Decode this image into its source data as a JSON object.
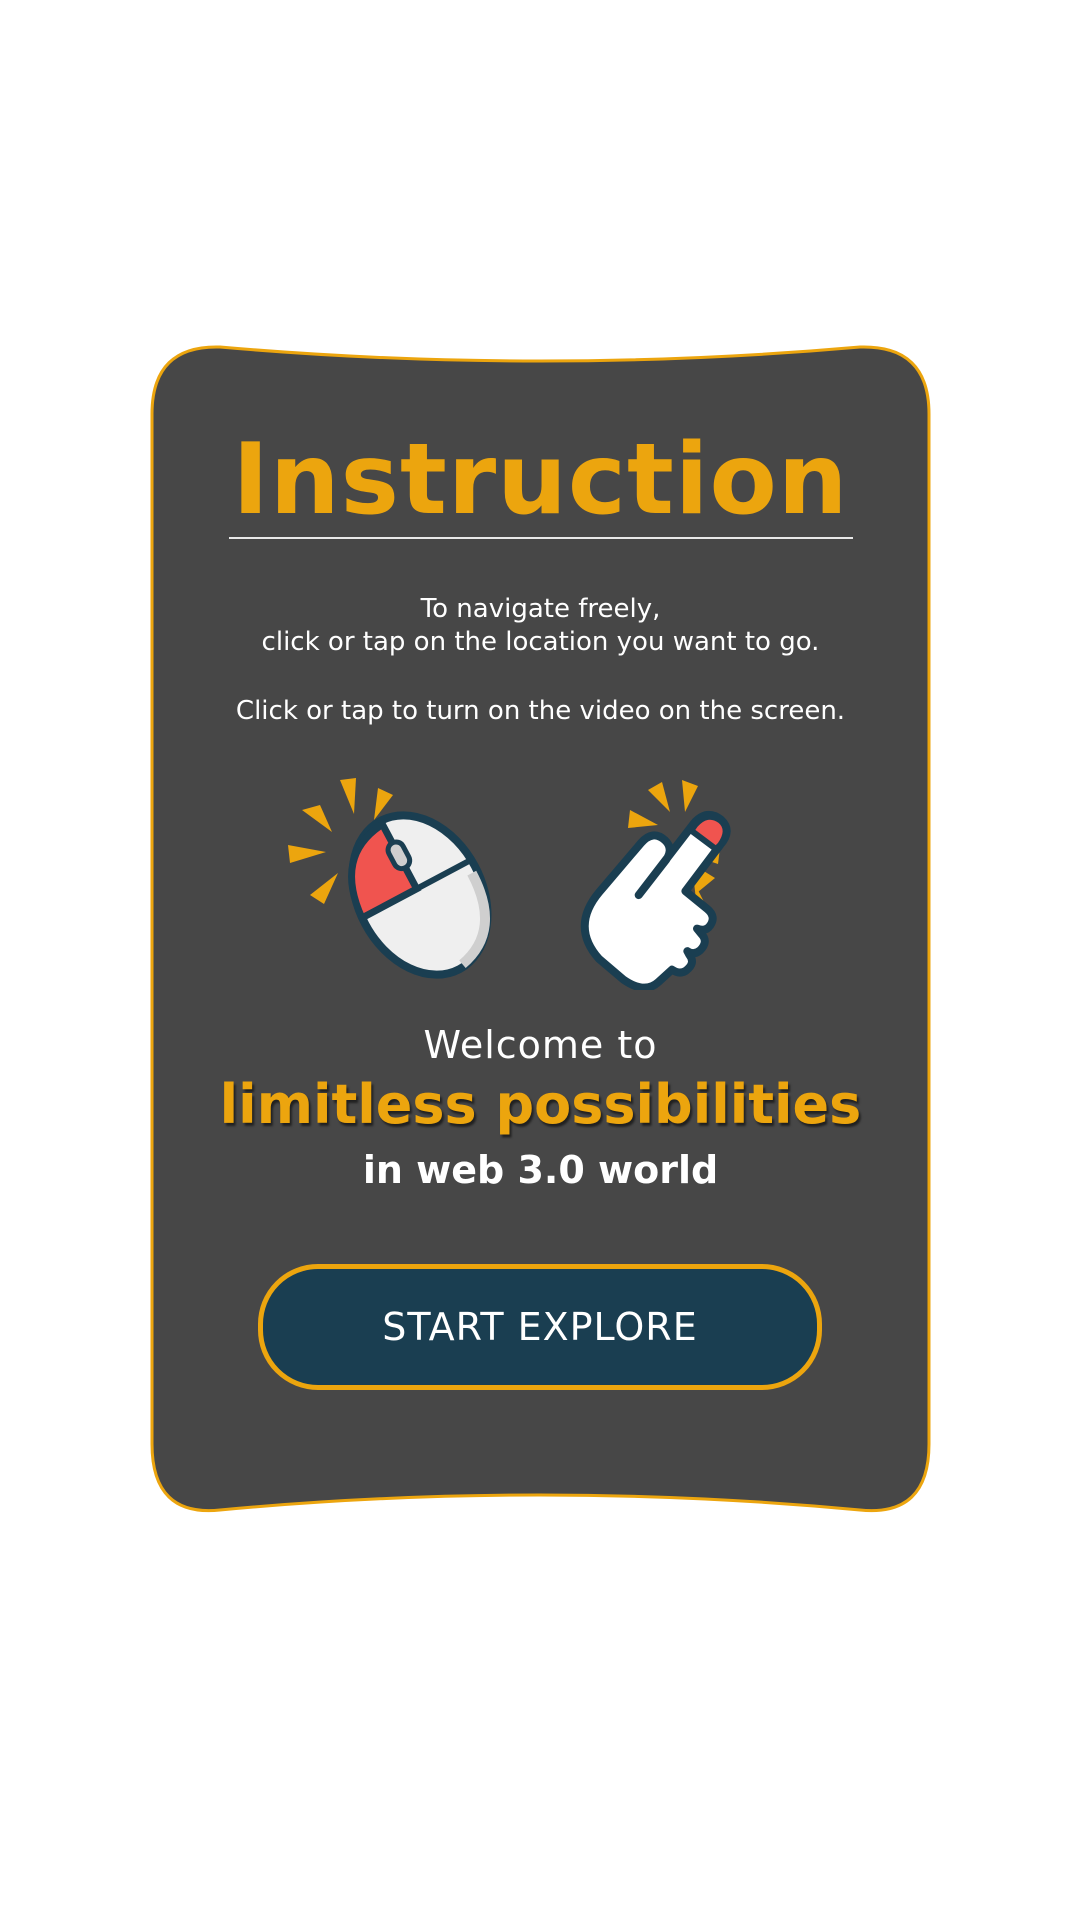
{
  "colors": {
    "page_background": "#ffffff",
    "card_background": "#474747",
    "card_border": "#ECA50E",
    "accent": "#ECA50E",
    "button_background": "#1A3E51",
    "text_light": "#ffffff"
  },
  "dialog": {
    "title": "Instruction",
    "instructions": [
      "To navigate freely,",
      "click or tap on the location you want to go.",
      "Click or tap to turn on the video on the screen."
    ],
    "icons": [
      "mouse-click-icon",
      "tap-hand-icon"
    ],
    "welcome_line": "Welcome to",
    "highlight_line": "limitless possibilities",
    "sub_line": "in web 3.0 world",
    "cta_label": "START EXPLORE"
  }
}
